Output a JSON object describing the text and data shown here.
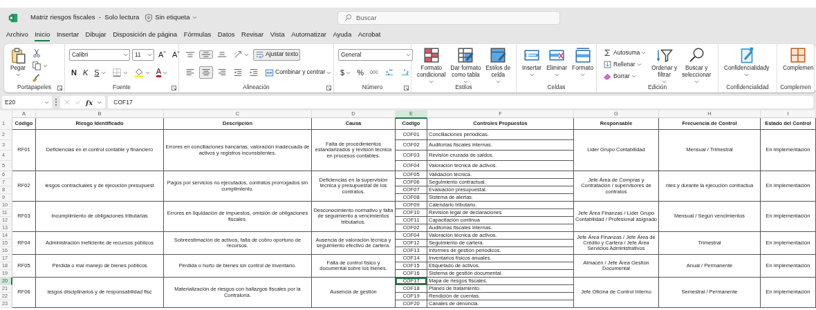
{
  "window": {
    "title": "Matriz riesgos fiscales  -  Solo lectura",
    "sensitivity": "Sin etiqueta"
  },
  "search": {
    "placeholder": "Buscar"
  },
  "menu": [
    {
      "label": "Archivo",
      "selected": false
    },
    {
      "label": "Inicio",
      "selected": true
    },
    {
      "label": "Insertar",
      "selected": false
    },
    {
      "label": "Dibujar",
      "selected": false
    },
    {
      "label": "Disposición de página",
      "selected": false
    },
    {
      "label": "Fórmulas",
      "selected": false
    },
    {
      "label": "Datos",
      "selected": false
    },
    {
      "label": "Revisar",
      "selected": false
    },
    {
      "label": "Vista",
      "selected": false
    },
    {
      "label": "Automatizar",
      "selected": false
    },
    {
      "label": "Ayuda",
      "selected": false
    },
    {
      "label": "Acrobat",
      "selected": false
    }
  ],
  "ribbon": [
    {
      "label": "Portapapeles",
      "launcher": true,
      "items": [
        {
          "kind": "big",
          "label": "Pegar",
          "caret": true
        },
        {
          "kind": "stack",
          "items": [
            {
              "kind": "icon"
            },
            {
              "kind": "icon",
              "caret": true
            },
            {
              "kind": "icon"
            }
          ]
        }
      ]
    },
    {
      "label": "Fuente",
      "launcher": true,
      "items": [
        {
          "kind": "lines",
          "lines": [
            {
              "items": [
                {
                  "kind": "select",
                  "value": "Calibri"
                },
                {
                  "kind": "select",
                  "value": "11"
                },
                {
                  "kind": "grow",
                  "label": "Aˆ"
                },
                {
                  "kind": "shrink",
                  "label": "Aˇ"
                }
              ]
            },
            {
              "items": [
                {
                  "kind": "bold",
                  "label": "N"
                },
                {
                  "kind": "italic",
                  "label": "K"
                },
                {
                  "kind": "underline",
                  "label": "S",
                  "caret": true
                },
                {
                  "kind": "icon",
                  "caret": true
                },
                {
                  "kind": "icon",
                  "caret": true
                },
                {
                  "kind": "fontcolor",
                  "label": "A",
                  "caret": true
                }
              ]
            }
          ]
        }
      ]
    },
    {
      "label": "Alineación",
      "launcher": true,
      "items": [
        {
          "kind": "lines",
          "lines": [
            {
              "items": [
                {
                  "kind": "toggle",
                  "selected": false
                },
                {
                  "kind": "toggle",
                  "selected": true
                },
                {
                  "kind": "toggle",
                  "selected": false
                },
                {
                  "kind": "icon",
                  "caret": true
                },
                {
                  "kind": "small",
                  "label": "Ajustar texto",
                  "selected": true
                }
              ]
            },
            {
              "items": [
                {
                  "kind": "toggle",
                  "selected": false
                },
                {
                  "kind": "toggle",
                  "selected": true
                },
                {
                  "kind": "toggle",
                  "selected": false
                },
                {
                  "kind": "icon"
                },
                {
                  "kind": "icon"
                },
                {
                  "kind": "small",
                  "label": "Combinar y centrar",
                  "selected": false,
                  "caret": true
                }
              ]
            }
          ]
        }
      ]
    },
    {
      "label": "Número",
      "launcher": true,
      "items": [
        {
          "kind": "lines",
          "lines": [
            {
              "items": [
                {
                  "kind": "select",
                  "value": "General"
                }
              ]
            },
            {
              "items": [
                {
                  "kind": "letter",
                  "label": "$",
                  "caret": true
                },
                {
                  "kind": "letter",
                  "label": "%"
                },
                {
                  "kind": "thousands",
                  "label": "000"
                },
                {
                  "kind": "icon"
                },
                {
                  "kind": "icon"
                }
              ]
            }
          ]
        }
      ]
    },
    {
      "label": "Estilos",
      "items": [
        {
          "kind": "big",
          "label": "Formato\ncondicional",
          "caret": true
        },
        {
          "kind": "big",
          "label": "Dar formato\ncomo tabla",
          "caret": true
        },
        {
          "kind": "big",
          "label": "Estilos de\ncelda",
          "caret": true
        }
      ]
    },
    {
      "label": "Celdas",
      "items": [
        {
          "kind": "big",
          "label": "Insertar",
          "caret": true
        },
        {
          "kind": "big",
          "label": "Eliminar",
          "caret": true
        },
        {
          "kind": "big",
          "label": "Formato",
          "caret": true
        }
      ]
    },
    {
      "label": "Edición",
      "items": [
        {
          "kind": "stack",
          "items": [
            {
              "kind": "small",
              "label": "Autosuma",
              "caret": true
            },
            {
              "kind": "small",
              "label": "Rellenar",
              "caret": true
            },
            {
              "kind": "small",
              "label": "Borrar",
              "caret": true
            }
          ]
        },
        {
          "kind": "big",
          "label": "Ordenar y\nfiltrar",
          "caret": true
        },
        {
          "kind": "big",
          "label": "Buscar y\nseleccionar",
          "caret": true
        }
      ]
    },
    {
      "label": "Confidencialidad",
      "items": [
        {
          "kind": "big",
          "label": "Confidencialidady",
          "caret": true
        }
      ]
    },
    {
      "label": "Complemen",
      "items": [
        {
          "kind": "big",
          "label": "Complemen"
        }
      ]
    }
  ],
  "formula_bar": {
    "cell": "E20",
    "function_label": "fx",
    "value": "COF17"
  },
  "sheet": {
    "columns": [
      {
        "letter": "A",
        "selected": false
      },
      {
        "letter": "B",
        "selected": false
      },
      {
        "letter": "C",
        "selected": false
      },
      {
        "letter": "D",
        "selected": false
      },
      {
        "letter": "E",
        "selected": true
      },
      {
        "letter": "F",
        "selected": false
      },
      {
        "letter": "G",
        "selected": false
      },
      {
        "letter": "H",
        "selected": false
      },
      {
        "letter": "I",
        "selected": false
      }
    ],
    "rows": [
      {
        "label": "1",
        "selected": false
      },
      {
        "label": "2",
        "selected": false
      },
      {
        "label": "3",
        "selected": false
      },
      {
        "label": "4",
        "selected": false
      },
      {
        "label": "5",
        "selected": false
      },
      {
        "label": "6",
        "selected": false
      },
      {
        "label": "7",
        "selected": false
      },
      {
        "label": "8",
        "selected": false
      },
      {
        "label": "9",
        "selected": false
      },
      {
        "label": "10",
        "selected": false
      },
      {
        "label": "11",
        "selected": false
      },
      {
        "label": "12",
        "selected": false
      },
      {
        "label": "13",
        "selected": false
      },
      {
        "label": "14",
        "selected": false
      },
      {
        "label": "15",
        "selected": false
      },
      {
        "label": "16",
        "selected": false
      },
      {
        "label": "17",
        "selected": false
      },
      {
        "label": "18",
        "selected": false
      },
      {
        "label": "19",
        "selected": false
      },
      {
        "label": "20",
        "selected": true
      },
      {
        "label": "21",
        "selected": false
      },
      {
        "label": "22",
        "selected": false
      },
      {
        "label": "23",
        "selected": false
      }
    ],
    "headers": [
      "Código",
      "Riesgo Identificado",
      "Descripción",
      "Causa",
      "Código",
      "Controles Propuestos",
      "Responsable",
      "Frecuencia de Control",
      "Estado del Control"
    ],
    "risks": [
      {
        "code": "RF01",
        "risk": "Deficiencias en el control contable y financiero",
        "description": "Errores en conciliaciones bancarias, valoración inadecuada de activos y registros inconsistentes.",
        "cause": "Falta de procedimientos estandarizados y revisión técnica en procesos contables.",
        "controls": [
          {
            "code": "COF01",
            "text": "Conciliaciones periódicas.",
            "selected": false
          },
          {
            "code": "COF02",
            "text": "Auditorías fiscales internas.",
            "selected": false
          },
          {
            "code": "COF03",
            "text": "Revisión cruzada de saldos.",
            "selected": false
          },
          {
            "code": "COF04",
            "text": "Valoración técnica de activos.",
            "selected": false
          }
        ],
        "responsible": "Lider Grupo Contabilidad",
        "frequency": "Mensual / Trimestral",
        "status": "En implementación"
      },
      {
        "code": "RF02",
        "risk": "iesgos contractuales y de ejecución presupuest",
        "description": "Pagos por servicios no ejecutados, contratos prorrogados sin cumplimiento.",
        "cause": "Deficiencias en la supervisión técnica y presupuestal de los contratos.",
        "controls": [
          {
            "code": "COF05",
            "text": "Validación técnica.",
            "selected": false
          },
          {
            "code": "COF06",
            "text": "Seguimiento contractual.",
            "selected": false
          },
          {
            "code": "COF07",
            "text": "Evaluación presupuestal.",
            "selected": false
          },
          {
            "code": "COF08",
            "text": "Sistema de alertas.",
            "selected": false
          }
        ],
        "responsible": "Jefe Área de Compras y Contratación / supervisores de contratos",
        "frequency": "ntes y durante la ejecución contractua",
        "status": "En implementación"
      },
      {
        "code": "RF03",
        "risk": "Incumplimiento de obligaciones tributarias",
        "description": "Errores en liquidación de impuestos, omisión de obligaciones fiscales.",
        "cause": "Desconocimiento normativo y falta de seguimiento a vencimientos tributarios.",
        "controls": [
          {
            "code": "COF09",
            "text": "Calendario tributario.",
            "selected": false
          },
          {
            "code": "COF10",
            "text": "Revisión legal de declaraciones",
            "selected": false
          },
          {
            "code": "COF11",
            "text": "Capacitación continua",
            "selected": false
          },
          {
            "code": "COF02",
            "text": "Auditorías fiscales internas.",
            "selected": false
          }
        ],
        "responsible": "Jefe Área Finanzas / Lider Grupo Contabilidad / Profesional asignado",
        "frequency": "Mensual / Según vencimientos",
        "status": "En implementación"
      },
      {
        "code": "RF04",
        "risk": "Administración ineficiente de recursos públicos",
        "description": "Sobreestimación de activos, falta de cobro oportuno de recursos.",
        "cause": "Ausencia de valoración técnica y seguimiento efectivo de cartera.",
        "controls": [
          {
            "code": "COF04",
            "text": "Valoración técnica de activos.",
            "selected": false
          },
          {
            "code": "COF12",
            "text": "Seguimiento de cartera.",
            "selected": false
          },
          {
            "code": "COF13",
            "text": "Informes de gestión periódicos.",
            "selected": false
          }
        ],
        "responsible": "Jefe Área Finanzas / Jefe Área de Crédito y Cartera / Jefe Área Servicios Administrativos",
        "frequency": "Trimestral",
        "status": "En implementación"
      },
      {
        "code": "RF05",
        "risk": "Pérdida o mal manejo de bienes públicos",
        "description": "Pérdida o hurto de bienes sin control de inventario.",
        "cause": "Falta de control físico y documental sobre los bienes.",
        "controls": [
          {
            "code": "COF14",
            "text": "Inventarios físicos anuales.",
            "selected": false
          },
          {
            "code": "COF15",
            "text": "Etiquetado de activos.",
            "selected": false
          },
          {
            "code": "COF16",
            "text": "Sistema de gestión documental.",
            "selected": false
          }
        ],
        "responsible": "Almacén / Jefe Área Gestión Documental",
        "frequency": "Anual / Permanente",
        "status": "En implementación"
      },
      {
        "code": "RF06",
        "risk": "iesgos disciplinarios y de responsabilidad fisc",
        "description": "Materialización de riesgos con hallazgos fiscales por la Contraloría.",
        "cause": "Ausencia de gestión",
        "controls": [
          {
            "code": "COF17",
            "text": "Mapa de riesgos fiscales.",
            "selected": true
          },
          {
            "code": "COF18",
            "text": "Planes de tratamiento.",
            "selected": false
          },
          {
            "code": "COF19",
            "text": "Rendición de cuentas.",
            "selected": false
          },
          {
            "code": "COF20",
            "text": "Canales de denuncia.",
            "selected": false
          }
        ],
        "responsible": "Jefe Oficina de Control Interno",
        "frequency": "Semestral / Permanente",
        "status": "En implementación"
      }
    ]
  }
}
